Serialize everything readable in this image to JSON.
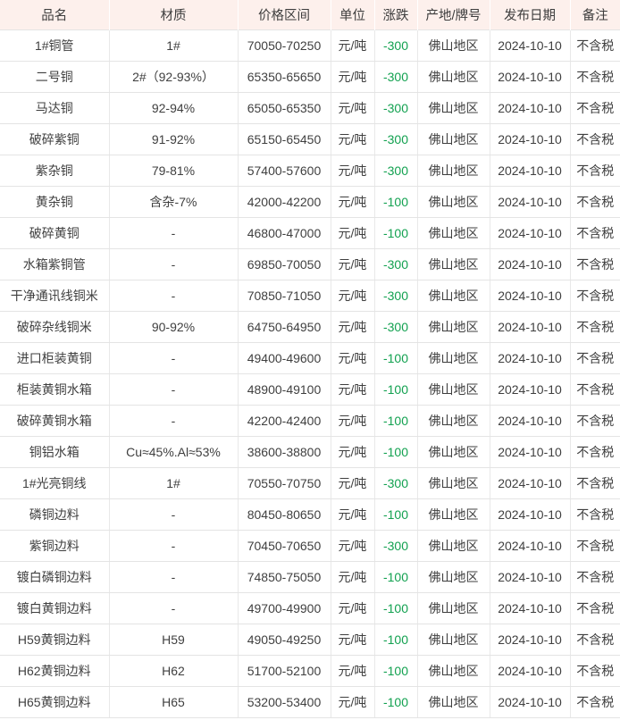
{
  "table": {
    "columns": [
      {
        "key": "name",
        "label": "品名"
      },
      {
        "key": "material",
        "label": "材质"
      },
      {
        "key": "price",
        "label": "价格区间"
      },
      {
        "key": "unit",
        "label": "单位"
      },
      {
        "key": "change",
        "label": "涨跌"
      },
      {
        "key": "origin",
        "label": "产地/牌号"
      },
      {
        "key": "date",
        "label": "发布日期"
      },
      {
        "key": "remark",
        "label": "备注"
      }
    ],
    "colors": {
      "header_background": "#fdf0ec",
      "change_negative": "#12a150",
      "row_border": "#e4e4e4",
      "text": "#3f3f3f"
    },
    "rows": [
      {
        "name": "1#铜管",
        "material": "1#",
        "price": "70050-70250",
        "unit": "元/吨",
        "change": "-300",
        "origin": "佛山地区",
        "date": "2024-10-10",
        "remark": "不含税"
      },
      {
        "name": "二号铜",
        "material": "2#（92-93%）",
        "price": "65350-65650",
        "unit": "元/吨",
        "change": "-300",
        "origin": "佛山地区",
        "date": "2024-10-10",
        "remark": "不含税"
      },
      {
        "name": "马达铜",
        "material": "92-94%",
        "price": "65050-65350",
        "unit": "元/吨",
        "change": "-300",
        "origin": "佛山地区",
        "date": "2024-10-10",
        "remark": "不含税"
      },
      {
        "name": "破碎紫铜",
        "material": "91-92%",
        "price": "65150-65450",
        "unit": "元/吨",
        "change": "-300",
        "origin": "佛山地区",
        "date": "2024-10-10",
        "remark": "不含税"
      },
      {
        "name": "紫杂铜",
        "material": "79-81%",
        "price": "57400-57600",
        "unit": "元/吨",
        "change": "-300",
        "origin": "佛山地区",
        "date": "2024-10-10",
        "remark": "不含税"
      },
      {
        "name": "黄杂铜",
        "material": "含杂-7%",
        "price": "42000-42200",
        "unit": "元/吨",
        "change": "-100",
        "origin": "佛山地区",
        "date": "2024-10-10",
        "remark": "不含税"
      },
      {
        "name": "破碎黄铜",
        "material": "-",
        "price": "46800-47000",
        "unit": "元/吨",
        "change": "-100",
        "origin": "佛山地区",
        "date": "2024-10-10",
        "remark": "不含税"
      },
      {
        "name": "水箱紫铜管",
        "material": "-",
        "price": "69850-70050",
        "unit": "元/吨",
        "change": "-300",
        "origin": "佛山地区",
        "date": "2024-10-10",
        "remark": "不含税"
      },
      {
        "name": "干净通讯线铜米",
        "material": "-",
        "price": "70850-71050",
        "unit": "元/吨",
        "change": "-300",
        "origin": "佛山地区",
        "date": "2024-10-10",
        "remark": "不含税"
      },
      {
        "name": "破碎杂线铜米",
        "material": "90-92%",
        "price": "64750-64950",
        "unit": "元/吨",
        "change": "-300",
        "origin": "佛山地区",
        "date": "2024-10-10",
        "remark": "不含税"
      },
      {
        "name": "进口柜装黄铜",
        "material": "-",
        "price": "49400-49600",
        "unit": "元/吨",
        "change": "-100",
        "origin": "佛山地区",
        "date": "2024-10-10",
        "remark": "不含税"
      },
      {
        "name": "柜装黄铜水箱",
        "material": "-",
        "price": "48900-49100",
        "unit": "元/吨",
        "change": "-100",
        "origin": "佛山地区",
        "date": "2024-10-10",
        "remark": "不含税"
      },
      {
        "name": "破碎黄铜水箱",
        "material": "-",
        "price": "42200-42400",
        "unit": "元/吨",
        "change": "-100",
        "origin": "佛山地区",
        "date": "2024-10-10",
        "remark": "不含税"
      },
      {
        "name": "铜铝水箱",
        "material": "Cu≈45%.Al≈53%",
        "price": "38600-38800",
        "unit": "元/吨",
        "change": "-100",
        "origin": "佛山地区",
        "date": "2024-10-10",
        "remark": "不含税"
      },
      {
        "name": "1#光亮铜线",
        "material": "1#",
        "price": "70550-70750",
        "unit": "元/吨",
        "change": "-300",
        "origin": "佛山地区",
        "date": "2024-10-10",
        "remark": "不含税"
      },
      {
        "name": "磷铜边料",
        "material": "-",
        "price": "80450-80650",
        "unit": "元/吨",
        "change": "-100",
        "origin": "佛山地区",
        "date": "2024-10-10",
        "remark": "不含税"
      },
      {
        "name": "紫铜边料",
        "material": "-",
        "price": "70450-70650",
        "unit": "元/吨",
        "change": "-300",
        "origin": "佛山地区",
        "date": "2024-10-10",
        "remark": "不含税"
      },
      {
        "name": "镀白磷铜边料",
        "material": "-",
        "price": "74850-75050",
        "unit": "元/吨",
        "change": "-100",
        "origin": "佛山地区",
        "date": "2024-10-10",
        "remark": "不含税"
      },
      {
        "name": "镀白黄铜边料",
        "material": "-",
        "price": "49700-49900",
        "unit": "元/吨",
        "change": "-100",
        "origin": "佛山地区",
        "date": "2024-10-10",
        "remark": "不含税"
      },
      {
        "name": "H59黄铜边料",
        "material": "H59",
        "price": "49050-49250",
        "unit": "元/吨",
        "change": "-100",
        "origin": "佛山地区",
        "date": "2024-10-10",
        "remark": "不含税"
      },
      {
        "name": "H62黄铜边料",
        "material": "H62",
        "price": "51700-52100",
        "unit": "元/吨",
        "change": "-100",
        "origin": "佛山地区",
        "date": "2024-10-10",
        "remark": "不含税"
      },
      {
        "name": "H65黄铜边料",
        "material": "H65",
        "price": "53200-53400",
        "unit": "元/吨",
        "change": "-100",
        "origin": "佛山地区",
        "date": "2024-10-10",
        "remark": "不含税"
      }
    ]
  }
}
